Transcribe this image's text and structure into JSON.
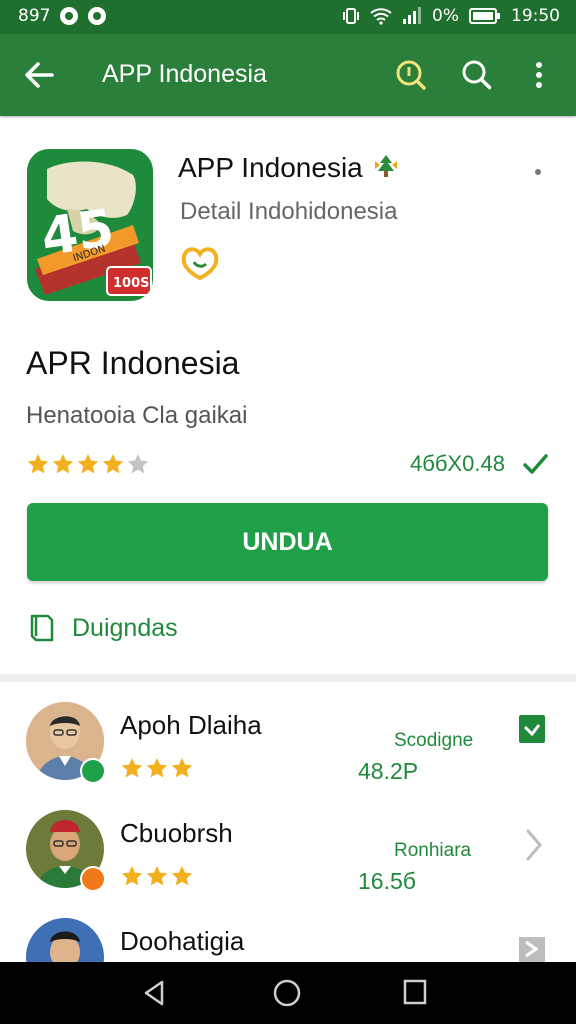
{
  "status_bar": {
    "carrier": "897",
    "battery_percent": "0%",
    "time": "19:50"
  },
  "app_bar": {
    "title": "APP Indonesia"
  },
  "app": {
    "name": "APP Indonesia",
    "developer": "Detail Indohidonesia",
    "icon_text_main": "45",
    "icon_text_badge": "100S",
    "icon_text_banner": "INDON",
    "headline": "APR Indonesia",
    "subheadline": "Henatooia Cla gaikai",
    "rating_stars": 4,
    "rating_max": 5,
    "rating_text": "4ббX0.48",
    "install_label": "UNDUA",
    "downloads_label": "Duigndas"
  },
  "reviews": [
    {
      "name": "Apoh Dlaiha",
      "stars": 3,
      "label": "Scodigne",
      "value": "48.2P",
      "action_icon": "check-box-icon"
    },
    {
      "name": "Cbuobrsh",
      "stars": 3,
      "label": "Ronhiara",
      "value": "16.5б",
      "action_icon": "chevron-right-icon"
    },
    {
      "name": "Doohatigia",
      "stars": 0,
      "label": "",
      "value": "",
      "action_icon": "arrow-right-icon"
    }
  ],
  "colors": {
    "app_bar": "#2a7f3a",
    "status_bar": "#1f6f2e",
    "accent": "#21a04a",
    "star": "#f2b01e",
    "star_empty": "#c4c4c4"
  }
}
